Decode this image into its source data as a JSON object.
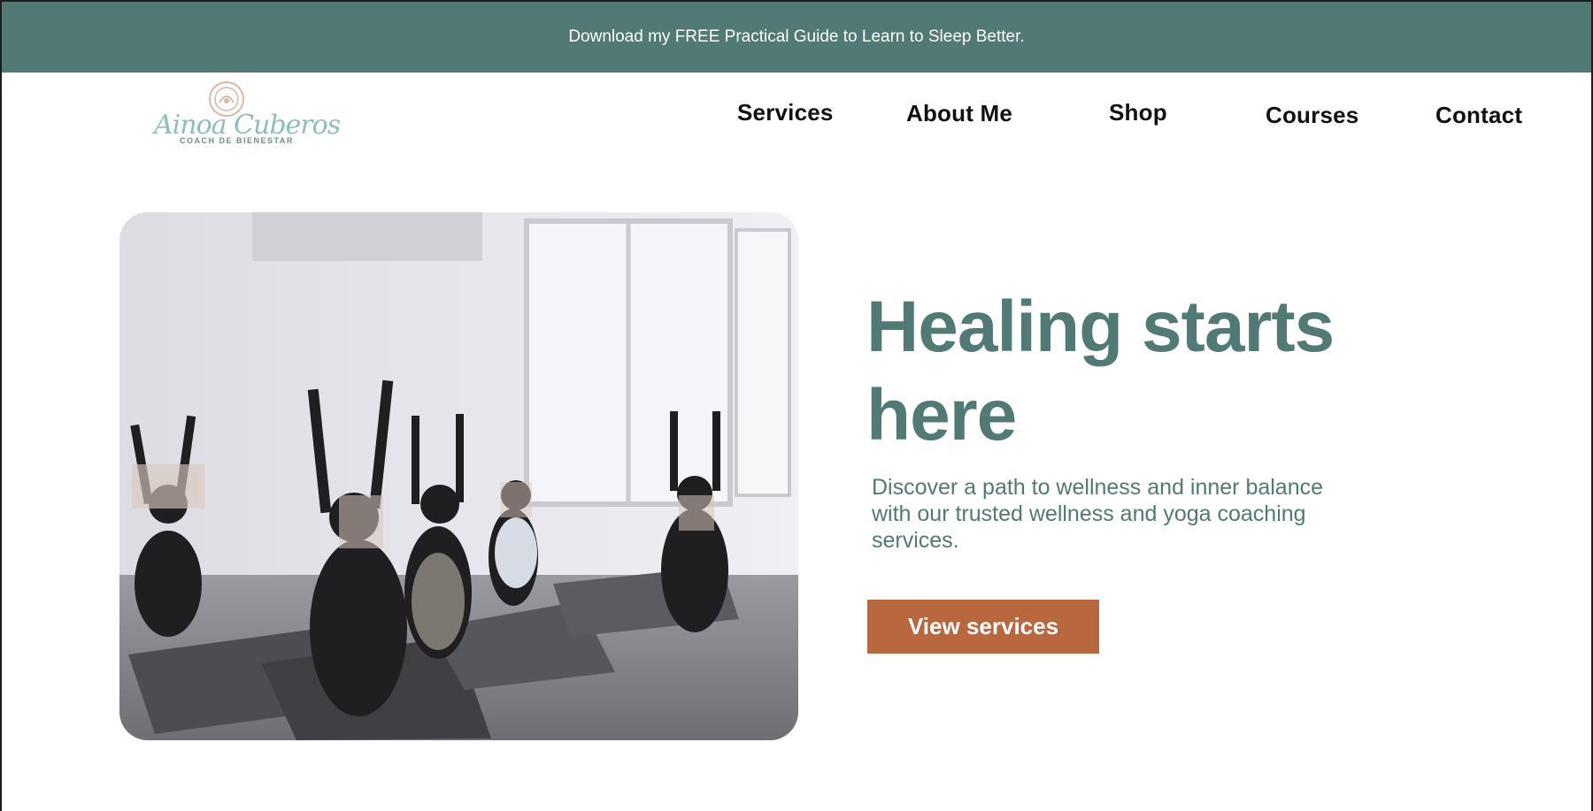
{
  "announcement": {
    "text": "Download my FREE Practical Guide to Learn to Sleep Better."
  },
  "logo": {
    "script_text": "Ainoa Cuberos",
    "subtitle": "COACH DE BIENESTAR",
    "colors": {
      "script": "#8dbfb5",
      "seal": "#d9b8a6"
    }
  },
  "nav": {
    "items": [
      {
        "label": "Services"
      },
      {
        "label": "About Me"
      },
      {
        "label": "Shop"
      },
      {
        "label": "Courses"
      },
      {
        "label": "Contact"
      }
    ]
  },
  "hero": {
    "image_icon": "yoga-class-photo",
    "title": "Healing starts here",
    "description": "Discover a path to wellness and inner balance with our trusted wellness and yoga coaching services.",
    "cta_label": "View services"
  },
  "colors": {
    "brand": "#517a74",
    "accent": "#b8673f",
    "text": "#111111",
    "background": "#ffffff"
  }
}
